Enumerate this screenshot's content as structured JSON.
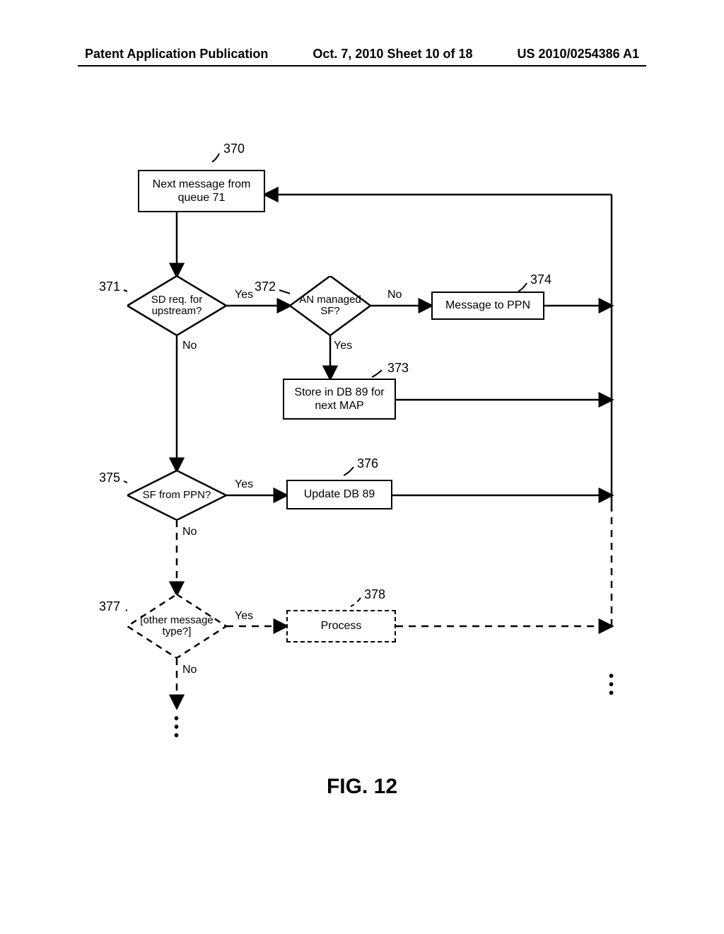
{
  "header": {
    "left": "Patent Application Publication",
    "center": "Oct. 7, 2010   Sheet 10 of 18",
    "right": "US 2010/0254386 A1"
  },
  "figure_caption": "FIG. 12",
  "nodes": {
    "n370": {
      "ref": "370",
      "text": "Next message from queue 71"
    },
    "n371": {
      "ref": "371",
      "text": "SD req. for upstream?"
    },
    "n372": {
      "ref": "372",
      "text": "AN managed SF?"
    },
    "n373": {
      "ref": "373",
      "text": "Store in DB 89 for next MAP"
    },
    "n374": {
      "ref": "374",
      "text": "Message to PPN"
    },
    "n375": {
      "ref": "375",
      "text": "SF from PPN?"
    },
    "n376": {
      "ref": "376",
      "text": "Update DB 89"
    },
    "n377": {
      "ref": "377",
      "text": "[other message type?]"
    },
    "n378": {
      "ref": "378",
      "text": "Process"
    }
  },
  "edges": {
    "yes": "Yes",
    "no": "No"
  },
  "chart_data": {
    "type": "flowchart",
    "title": "FIG. 12",
    "nodes": [
      {
        "id": "370",
        "kind": "process",
        "label": "Next message from queue 71"
      },
      {
        "id": "371",
        "kind": "decision",
        "label": "SD req. for upstream?"
      },
      {
        "id": "372",
        "kind": "decision",
        "label": "AN managed SF?"
      },
      {
        "id": "373",
        "kind": "process",
        "label": "Store in DB 89 for next MAP"
      },
      {
        "id": "374",
        "kind": "process",
        "label": "Message to PPN"
      },
      {
        "id": "375",
        "kind": "decision",
        "label": "SF from PPN?"
      },
      {
        "id": "376",
        "kind": "process",
        "label": "Update DB 89"
      },
      {
        "id": "377",
        "kind": "decision",
        "label": "[other message type?]",
        "style": "dashed"
      },
      {
        "id": "378",
        "kind": "process",
        "label": "Process",
        "style": "dashed"
      }
    ],
    "edges": [
      {
        "from": "370",
        "to": "371"
      },
      {
        "from": "371",
        "to": "372",
        "label": "Yes"
      },
      {
        "from": "371",
        "to": "375",
        "label": "No"
      },
      {
        "from": "372",
        "to": "374",
        "label": "No"
      },
      {
        "from": "372",
        "to": "373",
        "label": "Yes"
      },
      {
        "from": "374",
        "to": "370"
      },
      {
        "from": "373",
        "to": "370"
      },
      {
        "from": "375",
        "to": "376",
        "label": "Yes"
      },
      {
        "from": "375",
        "to": "377",
        "label": "No",
        "style": "dashed"
      },
      {
        "from": "376",
        "to": "370"
      },
      {
        "from": "377",
        "to": "378",
        "label": "Yes",
        "style": "dashed"
      },
      {
        "from": "378",
        "to": "370",
        "style": "dashed"
      },
      {
        "from": "377",
        "to": "continuation",
        "label": "No",
        "style": "dashed"
      }
    ]
  }
}
